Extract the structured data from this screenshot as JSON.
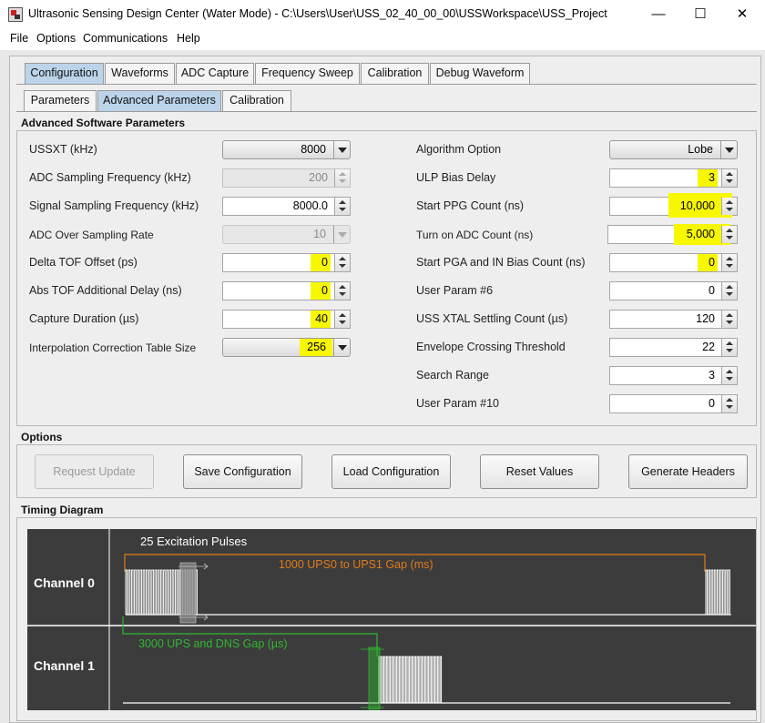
{
  "window": {
    "title": "Ultrasonic Sensing Design Center (Water Mode) - C:\\Users\\User\\USS_02_40_00_00\\USSWorkspace\\USS_Project",
    "minimize": "—",
    "maximize": "☐",
    "close": "✕"
  },
  "menu": {
    "file": "File",
    "options": "Options",
    "communications": "Communications",
    "help": "Help"
  },
  "main_tabs": [
    "Configuration",
    "Waveforms",
    "ADC Capture",
    "Frequency Sweep",
    "Calibration",
    "Debug Waveform"
  ],
  "sub_tabs": [
    "Parameters",
    "Advanced Parameters",
    "Calibration"
  ],
  "advanced": {
    "title": "Advanced Software Parameters",
    "left": [
      {
        "label": "USSXT (kHz)",
        "value": "8000",
        "kind": "combo"
      },
      {
        "label": "ADC Sampling Frequency (kHz)",
        "value": "200",
        "kind": "spinner-disabled"
      },
      {
        "label": "Signal Sampling Frequency (kHz)",
        "value": "8000.0",
        "kind": "spinner"
      },
      {
        "label": "ADC Over Sampling Rate",
        "value": "10",
        "kind": "combo-disabled"
      },
      {
        "label": "Delta TOF Offset (ps)",
        "value": "0",
        "kind": "spinner",
        "highlighted": true
      },
      {
        "label": "Abs TOF Additional Delay (ns)",
        "value": "0",
        "kind": "spinner",
        "highlighted": true
      },
      {
        "label": "Capture Duration (µs)",
        "value": "40",
        "kind": "spinner",
        "highlighted": true
      },
      {
        "label": "Interpolation Correction Table Size",
        "value": "256",
        "kind": "combo",
        "highlighted": true
      }
    ],
    "right": [
      {
        "label": "Algorithm Option",
        "value": "Lobe",
        "kind": "combo"
      },
      {
        "label": "ULP Bias Delay",
        "value": "3",
        "kind": "spinner",
        "highlighted": true
      },
      {
        "label": "Start PPG Count (ns)",
        "value": "10,000",
        "kind": "spinner",
        "highlighted": true
      },
      {
        "label": "Turn on ADC Count (ns)",
        "value": "5,000",
        "kind": "spinner",
        "highlighted": true
      },
      {
        "label": "Start PGA and IN Bias Count (ns)",
        "value": "0",
        "kind": "spinner",
        "highlighted": true
      },
      {
        "label": "User Param #6",
        "value": "0",
        "kind": "spinner"
      },
      {
        "label": "USS XTAL Settling Count (µs)",
        "value": "120",
        "kind": "spinner"
      },
      {
        "label": "Envelope Crossing Threshold",
        "value": "22",
        "kind": "spinner"
      },
      {
        "label": "Search Range",
        "value": "3",
        "kind": "spinner"
      },
      {
        "label": "User Param #10",
        "value": "0",
        "kind": "spinner"
      }
    ]
  },
  "options": {
    "title": "Options",
    "buttons": [
      "Request Update",
      "Save Configuration",
      "Load Configuration",
      "Reset Values",
      "Generate Headers"
    ]
  },
  "timing": {
    "title": "Timing Diagram",
    "channel0": "Channel 0",
    "channel1": "Channel 1",
    "pulses_label": "25 Excitation Pulses",
    "gap0_label": "1000 UPS0 to UPS1 Gap (ms)",
    "gap1_label": "3000 UPS and DNS Gap (µs)"
  },
  "colors": {
    "highlight": "#f7f700",
    "orange": "#e07b1a",
    "green": "#2fb82f",
    "active_tab": "#bcd4ea"
  }
}
